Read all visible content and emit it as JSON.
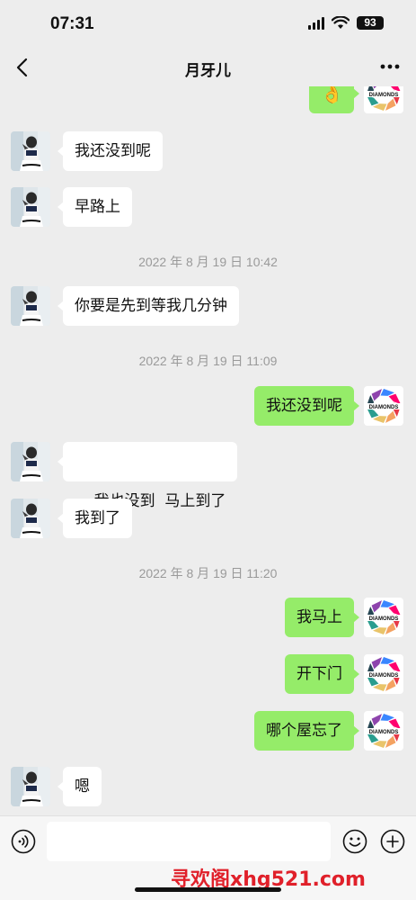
{
  "status_bar": {
    "time": "07:31",
    "battery": "93"
  },
  "header": {
    "title": "月牙儿"
  },
  "messages": [
    {
      "side": "out",
      "text": "👌"
    },
    {
      "side": "in",
      "text": "我还没到呢"
    },
    {
      "side": "in",
      "text": "早路上"
    },
    {
      "type": "time",
      "text": "2022 年 8 月 19 日 10:42"
    },
    {
      "side": "in",
      "text": "你要是先到等我几分钟"
    },
    {
      "type": "time",
      "text": "2022 年 8 月 19 日 11:09"
    },
    {
      "side": "out",
      "text": "我还没到呢"
    },
    {
      "side": "in",
      "text": "我也没到  马上到了"
    },
    {
      "side": "in",
      "text": "我到了"
    },
    {
      "type": "time",
      "text": "2022 年 8 月 19 日 11:20"
    },
    {
      "side": "out",
      "text": "我马上"
    },
    {
      "side": "out",
      "text": "开下门"
    },
    {
      "side": "out",
      "text": "哪个屋忘了"
    },
    {
      "side": "in",
      "text": "嗯"
    }
  ],
  "self_avatar": {
    "brand_text": "DIAMONDS"
  },
  "input_bar": {
    "placeholder": ""
  },
  "watermark": {
    "text": "寻欢阁xhg521.com"
  },
  "colors": {
    "outgoing_bubble": "#95ec69",
    "incoming_bubble": "#ffffff",
    "background": "#ededed",
    "watermark": "#e0202a"
  },
  "icons": {
    "back": "chevron-left-icon",
    "more": "more-dots-icon",
    "voice": "voice-icon",
    "emoji": "emoji-icon",
    "plus": "plus-icon"
  }
}
